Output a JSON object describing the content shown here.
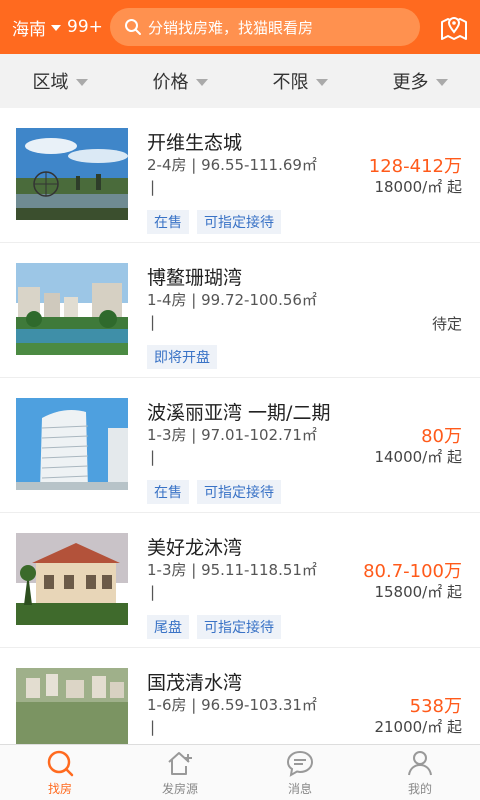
{
  "header": {
    "city": "海南",
    "badge": "99+",
    "search_placeholder": "分销找房难，找猫眼看房",
    "icons": {
      "dropdown": "triangle-down-icon",
      "search": "search-icon",
      "location": "map-pin-icon"
    }
  },
  "filters": [
    {
      "label": "区域"
    },
    {
      "label": "价格"
    },
    {
      "label": "不限"
    },
    {
      "label": "更多"
    }
  ],
  "listings": [
    {
      "name": "开维生态城",
      "spec": "2-4房 | 96.55-111.69㎡",
      "bar": "|",
      "price": "128-412万",
      "unit": "18000/㎡ 起",
      "tags": [
        "在售",
        "可指定接待"
      ]
    },
    {
      "name": "博鳌珊瑚湾",
      "spec": "1-4房 | 99.72-100.56㎡",
      "bar": "|",
      "price": "",
      "unit": "待定",
      "tags": [
        "即将开盘"
      ]
    },
    {
      "name": "波溪丽亚湾 一期/二期",
      "spec": "1-3房 | 97.01-102.71㎡",
      "bar": "|",
      "price": "80万",
      "unit": "14000/㎡ 起",
      "tags": [
        "在售",
        "可指定接待"
      ]
    },
    {
      "name": "美好龙沐湾",
      "spec": "1-3房 | 95.11-118.51㎡",
      "bar": "|",
      "price": "80.7-100万",
      "unit": "15800/㎡ 起",
      "tags": [
        "尾盘",
        "可指定接待"
      ]
    },
    {
      "name": "国茂清水湾",
      "spec": "1-6房 | 96.59-103.31㎡",
      "bar": "|",
      "price": "538万",
      "unit": "21000/㎡ 起",
      "tags": []
    }
  ],
  "nav": [
    {
      "label": "找房",
      "icon": "search-icon",
      "active": true
    },
    {
      "label": "发房源",
      "icon": "house-plus-icon",
      "active": false
    },
    {
      "label": "消息",
      "icon": "chat-bubble-icon",
      "active": false
    },
    {
      "label": "我的",
      "icon": "person-icon",
      "active": false
    }
  ],
  "colors": {
    "accent": "#ff6a1f",
    "price": "#ff5a1a",
    "tag_text": "#3a73c6",
    "tag_bg": "#eef2f8"
  }
}
